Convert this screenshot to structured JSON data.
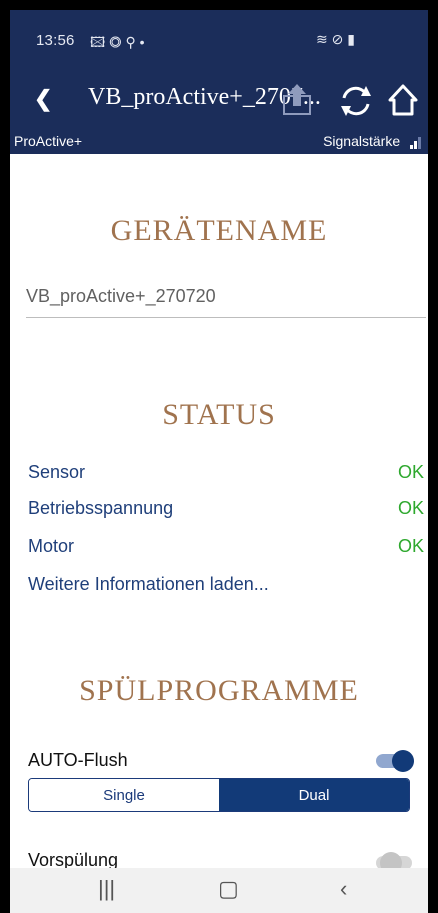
{
  "status_bar": {
    "time": "13:56",
    "left_icons": "🖾 ◎ ⚲ •",
    "right_icons": "≋ ⊘ ▮"
  },
  "header": {
    "title": "VB_proActive+_2707...",
    "back_icon": "❮"
  },
  "subheader": {
    "left": "ProActive+",
    "right": "Signalstärke"
  },
  "device_section": {
    "title": "GERÄTENAME",
    "device_name": "VB_proActive+_270720"
  },
  "status_section": {
    "title": "STATUS",
    "items": [
      {
        "label": "Sensor",
        "value": "OK"
      },
      {
        "label": "Betriebsspannung",
        "value": "OK"
      },
      {
        "label": "Motor",
        "value": "OK"
      }
    ],
    "more_link": "Weitere Informationen laden..."
  },
  "programs_section": {
    "title": "SPÜLPROGRAMME",
    "auto_flush_label": "AUTO-Flush",
    "auto_flush_on": true,
    "segments": [
      "Single",
      "Dual"
    ],
    "selected_segment": "Dual",
    "prerinse_label": "Vorspülung",
    "prerinse_on": false
  },
  "nav": {
    "recent": "|||",
    "home": "▢",
    "back": "‹"
  },
  "colors": {
    "primary": "#1b2d5a",
    "accent": "#a0734e",
    "ok": "#2ea82e",
    "link": "#1f3f7a"
  }
}
